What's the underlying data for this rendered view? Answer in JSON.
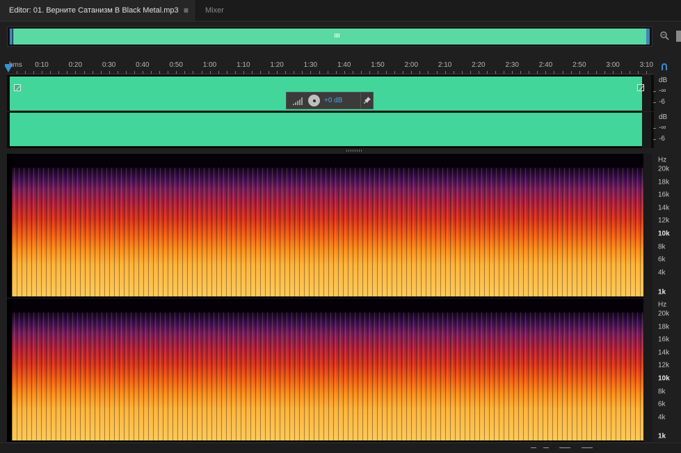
{
  "tabs": {
    "editor_label": "Editor: 01. Верните Сатанизм В Black Metal.mp3",
    "editor_menu_icon": "≡",
    "mixer_label": "Mixer"
  },
  "ruler": {
    "unit": "hms",
    "ticks": [
      "0:10",
      "0:20",
      "0:30",
      "0:40",
      "0:50",
      "1:00",
      "1:10",
      "1:20",
      "1:30",
      "1:40",
      "1:50",
      "2:00",
      "2:10",
      "2:20",
      "2:30",
      "2:40",
      "2:50",
      "3:00",
      "3:10"
    ]
  },
  "hud": {
    "value": "+0 dB"
  },
  "db_scale": {
    "top": {
      "unit": "dB",
      "infinity": "-∞",
      "minus6": "-6"
    },
    "bottom": {
      "unit": "dB",
      "infinity": "-∞",
      "minus6": "-6"
    }
  },
  "hz_scale": {
    "top": {
      "unit": "Hz",
      "labels": [
        "20k",
        "18k",
        "16k",
        "14k",
        "12k",
        "10k",
        "8k",
        "6k",
        "4k",
        "1k"
      ]
    },
    "bottom": {
      "unit": "Hz",
      "labels": [
        "20k",
        "18k",
        "16k",
        "14k",
        "12k",
        "10k",
        "8k",
        "6k",
        "4k",
        "1k"
      ]
    }
  },
  "colors": {
    "waveform": "#43d69b",
    "overview": "#5bd9a2",
    "accent": "#3a8fd0",
    "hud_value": "#4aa6e8"
  },
  "icons": {
    "tab_menu": "hamburger-menu-icon",
    "zoom": "zoom-icon",
    "snap": "snap-magnet-icon",
    "volume_knob": "volume-knob-icon",
    "pin": "pin-icon",
    "level_bars": "level-bars-icon"
  }
}
